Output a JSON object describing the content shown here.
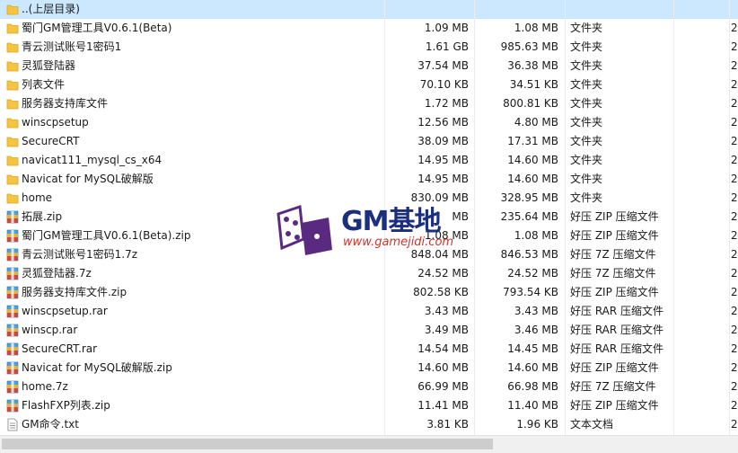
{
  "rows": [
    {
      "name": "..(上层目录)",
      "size": "",
      "packed": "",
      "type": "",
      "extra": "",
      "icon": "folder-icon",
      "selected": true
    },
    {
      "name": "蜀门GM管理工具V0.6.1(Beta)",
      "size": "1.09 MB",
      "packed": "1.08 MB",
      "type": "文件夹",
      "extra": "2",
      "icon": "folder-icon"
    },
    {
      "name": "青云测试账号1密码1",
      "size": "1.61 GB",
      "packed": "985.63 MB",
      "type": "文件夹",
      "extra": "2",
      "icon": "folder-icon"
    },
    {
      "name": "灵狐登陆器",
      "size": "37.54 MB",
      "packed": "36.38 MB",
      "type": "文件夹",
      "extra": "2",
      "icon": "folder-icon"
    },
    {
      "name": "列表文件",
      "size": "70.10 KB",
      "packed": "34.51 KB",
      "type": "文件夹",
      "extra": "2",
      "icon": "folder-icon"
    },
    {
      "name": "服务器支持库文件",
      "size": "1.72 MB",
      "packed": "800.81 KB",
      "type": "文件夹",
      "extra": "2",
      "icon": "folder-icon"
    },
    {
      "name": "winscpsetup",
      "size": "12.56 MB",
      "packed": "4.80 MB",
      "type": "文件夹",
      "extra": "2",
      "icon": "folder-icon"
    },
    {
      "name": "SecureCRT",
      "size": "38.09 MB",
      "packed": "17.31 MB",
      "type": "文件夹",
      "extra": "2",
      "icon": "folder-icon"
    },
    {
      "name": "navicat111_mysql_cs_x64",
      "size": "14.95 MB",
      "packed": "14.60 MB",
      "type": "文件夹",
      "extra": "2",
      "icon": "folder-icon"
    },
    {
      "name": "Navicat for MySQL破解版",
      "size": "14.95 MB",
      "packed": "14.60 MB",
      "type": "文件夹",
      "extra": "2",
      "icon": "folder-icon"
    },
    {
      "name": "home",
      "size": "830.09 MB",
      "packed": "328.95 MB",
      "type": "文件夹",
      "extra": "2",
      "icon": "folder-icon"
    },
    {
      "name": "拓展.zip",
      "size": "MB",
      "packed": "235.64 MB",
      "type": "好压 ZIP 压缩文件",
      "extra": "2",
      "icon": "archive-icon"
    },
    {
      "name": "蜀门GM管理工具V0.6.1(Beta).zip",
      "size": "1.08 MB",
      "packed": "1.08 MB",
      "type": "好压 ZIP 压缩文件",
      "extra": "2",
      "icon": "archive-icon"
    },
    {
      "name": "青云测试账号1密码1.7z",
      "size": "848.04 MB",
      "packed": "846.53 MB",
      "type": "好压 7Z 压缩文件",
      "extra": "2",
      "icon": "archive-icon"
    },
    {
      "name": "灵狐登陆器.7z",
      "size": "24.52 MB",
      "packed": "24.52 MB",
      "type": "好压 7Z 压缩文件",
      "extra": "2",
      "icon": "archive-icon"
    },
    {
      "name": "服务器支持库文件.zip",
      "size": "802.58 KB",
      "packed": "793.54 KB",
      "type": "好压 ZIP 压缩文件",
      "extra": "2",
      "icon": "archive-icon"
    },
    {
      "name": "winscpsetup.rar",
      "size": "3.43 MB",
      "packed": "3.43 MB",
      "type": "好压 RAR 压缩文件",
      "extra": "2",
      "icon": "archive-icon"
    },
    {
      "name": "winscp.rar",
      "size": "3.49 MB",
      "packed": "3.46 MB",
      "type": "好压 RAR 压缩文件",
      "extra": "2",
      "icon": "archive-icon"
    },
    {
      "name": "SecureCRT.rar",
      "size": "14.54 MB",
      "packed": "14.45 MB",
      "type": "好压 RAR 压缩文件",
      "extra": "2",
      "icon": "archive-icon"
    },
    {
      "name": "Navicat for MySQL破解版.zip",
      "size": "14.60 MB",
      "packed": "14.60 MB",
      "type": "好压 ZIP 压缩文件",
      "extra": "2",
      "icon": "archive-icon"
    },
    {
      "name": "home.7z",
      "size": "66.99 MB",
      "packed": "66.98 MB",
      "type": "好压 7Z 压缩文件",
      "extra": "2",
      "icon": "archive-icon"
    },
    {
      "name": "FlashFXP列表.zip",
      "size": "11.41 MB",
      "packed": "11.40 MB",
      "type": "好压 ZIP 压缩文件",
      "extra": "2",
      "icon": "archive-icon"
    },
    {
      "name": "GM命令.txt",
      "size": "3.81 KB",
      "packed": "1.96 KB",
      "type": "文本文档",
      "extra": "2",
      "icon": "text-file-icon"
    }
  ],
  "watermark": {
    "title": "GM基地",
    "url": "www.gamejidi.com"
  },
  "colors": {
    "selected_row": "#cce8ff",
    "folder": "#f5c542",
    "watermark_blue": "#1c2f7e",
    "watermark_red": "#d0342c"
  }
}
